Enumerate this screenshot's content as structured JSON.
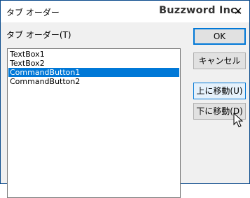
{
  "window": {
    "title": "タブ オーダー",
    "brand": "Buzzword Inc.",
    "close_glyph": "✕"
  },
  "list": {
    "label": "タブ オーダー(T)",
    "items": [
      {
        "text": "TextBox1",
        "selected": false
      },
      {
        "text": "TextBox2",
        "selected": false
      },
      {
        "text": "CommandButton1",
        "selected": true
      },
      {
        "text": "CommandButton2",
        "selected": false
      }
    ]
  },
  "buttons": {
    "ok": "OK",
    "cancel": "キャンセル",
    "move_up": "上に移動(U)",
    "move_down": "下に移動(D)"
  },
  "colors": {
    "selection": "#0078d7",
    "title_border": "#0a4a8c",
    "dialog_bg": "#f0f0f0"
  },
  "icons": {
    "close": "close-icon",
    "pointer": "mouse-pointer-icon"
  }
}
